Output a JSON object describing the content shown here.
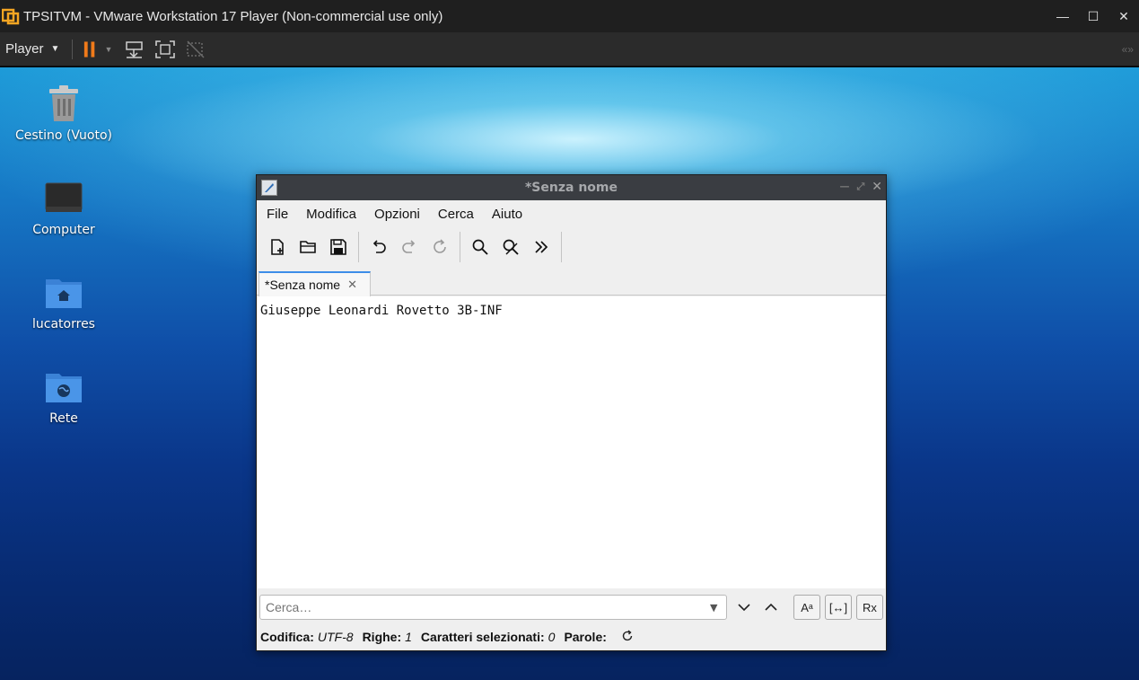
{
  "vmware": {
    "title": "TPSITVM - VMware Workstation 17 Player (Non-commercial use only)",
    "player_menu": "Player",
    "window_controls": {
      "minimize": "—",
      "maximize": "☐",
      "close": "✕"
    },
    "toolbar_icons": [
      "pause-icon",
      "send-ctrl-alt-del-icon",
      "fullscreen-icon",
      "unity-icon"
    ],
    "colors": {
      "pause_accent": "#f07a1a"
    }
  },
  "desktop": {
    "icons": [
      {
        "label": "Cestino (Vuoto)",
        "icon": "trash-icon"
      },
      {
        "label": "Computer",
        "icon": "computer-icon"
      },
      {
        "label": "lucatorres",
        "icon": "home-folder-icon"
      },
      {
        "label": "Rete",
        "icon": "network-folder-icon"
      }
    ]
  },
  "editor_window": {
    "title": "*Senza nome",
    "menu": [
      "File",
      "Modifica",
      "Opzioni",
      "Cerca",
      "Aiuto"
    ],
    "tab_label": "*Senza nome",
    "tab_close": "✕",
    "content": "Giuseppe Leonardi Rovetto 3B-INF",
    "search": {
      "placeholder": "Cerca…",
      "match_case": "Aᵃ",
      "whole_word": "[↔]",
      "regex": "Rx"
    },
    "status": {
      "encoding_label": "Codifica:",
      "encoding_value": "UTF-8",
      "lines_label": "Righe:",
      "lines_value": "1",
      "selected_label": "Caratteri selezionati:",
      "selected_value": "0",
      "words_label": "Parole:"
    },
    "colors": {
      "titlebar": "#3a3d42",
      "tab_accent": "#3d8ee8"
    }
  }
}
